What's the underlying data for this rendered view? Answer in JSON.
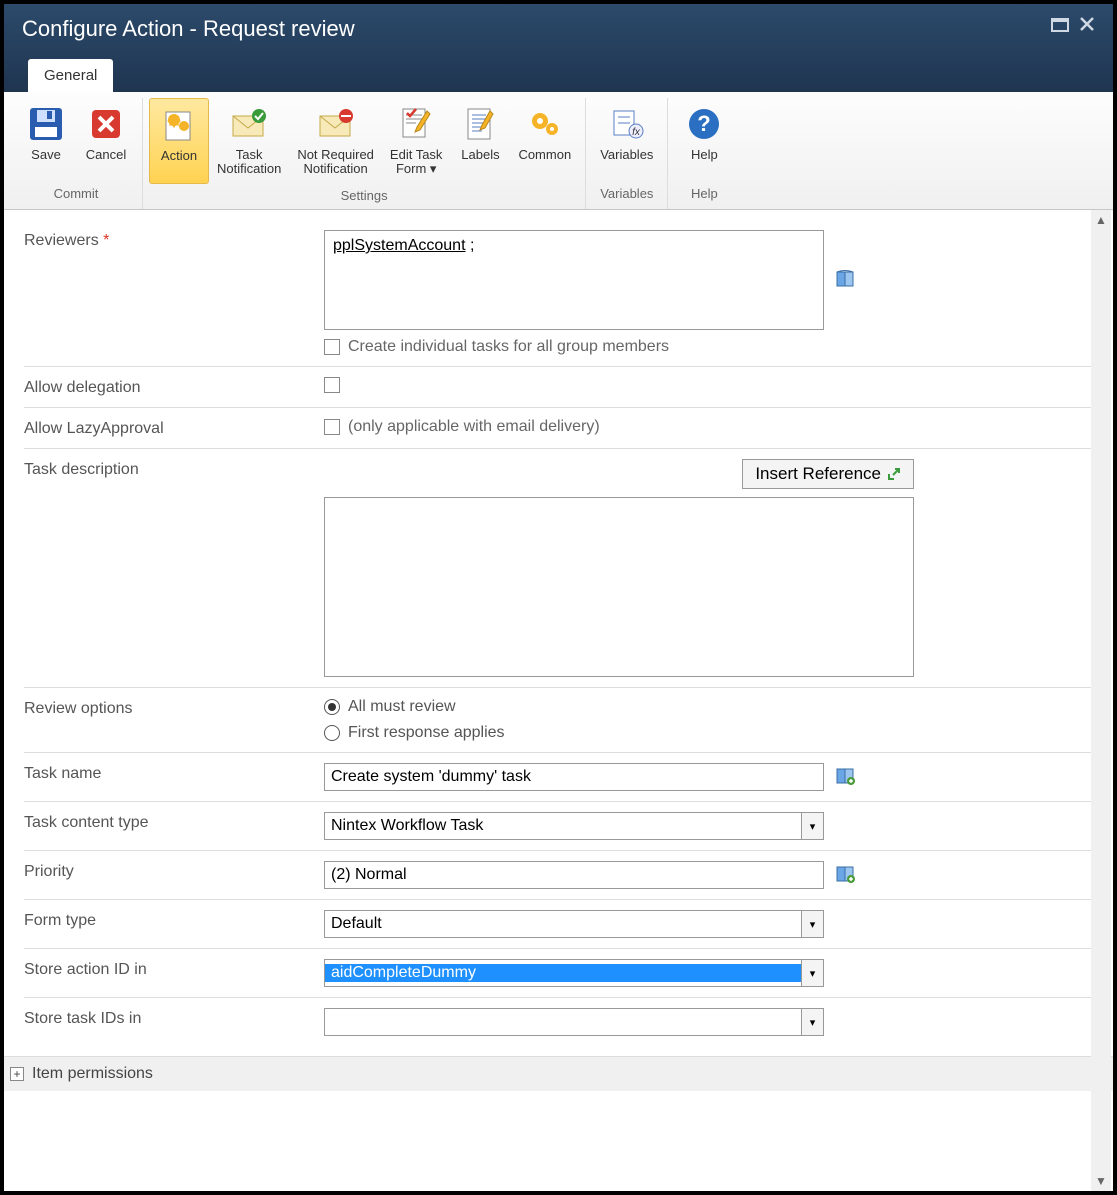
{
  "window": {
    "title": "Configure Action - Request review"
  },
  "tab": {
    "label": "General"
  },
  "ribbon": {
    "groups": [
      {
        "label": "Commit",
        "items": [
          {
            "name": "save",
            "label": "Save"
          },
          {
            "name": "cancel",
            "label": "Cancel"
          }
        ]
      },
      {
        "label": "Settings",
        "items": [
          {
            "name": "action",
            "label": "Action",
            "active": true
          },
          {
            "name": "task-notification",
            "label": "Task\nNotification"
          },
          {
            "name": "not-required-notification",
            "label": "Not Required\nNotification"
          },
          {
            "name": "edit-task-form",
            "label": "Edit Task\nForm ▾"
          },
          {
            "name": "labels",
            "label": "Labels"
          },
          {
            "name": "common",
            "label": "Common"
          }
        ]
      },
      {
        "label": "Variables",
        "items": [
          {
            "name": "variables",
            "label": "Variables"
          }
        ]
      },
      {
        "label": "Help",
        "items": [
          {
            "name": "help",
            "label": "Help"
          }
        ]
      }
    ]
  },
  "form": {
    "reviewers_label": "Reviewers",
    "reviewers_value": "pplSystemAccount",
    "reviewers_suffix": " ;",
    "create_individual_label": "Create individual tasks for all group members",
    "allow_delegation_label": "Allow delegation",
    "allow_lazy_label": "Allow LazyApproval",
    "lazy_hint": "(only applicable with email delivery)",
    "task_description_label": "Task description",
    "insert_reference_label": "Insert Reference",
    "review_options_label": "Review options",
    "review_opt1": "All must review",
    "review_opt2": "First response applies",
    "task_name_label": "Task name",
    "task_name_value": "Create system 'dummy' task",
    "task_content_type_label": "Task content type",
    "task_content_type_value": "Nintex Workflow Task",
    "priority_label": "Priority",
    "priority_value": "(2) Normal",
    "form_type_label": "Form type",
    "form_type_value": "Default",
    "store_action_label": "Store action ID in",
    "store_action_value": "aidCompleteDummy",
    "store_task_label": "Store task IDs in",
    "store_task_value": "",
    "item_permissions_label": "Item permissions"
  }
}
